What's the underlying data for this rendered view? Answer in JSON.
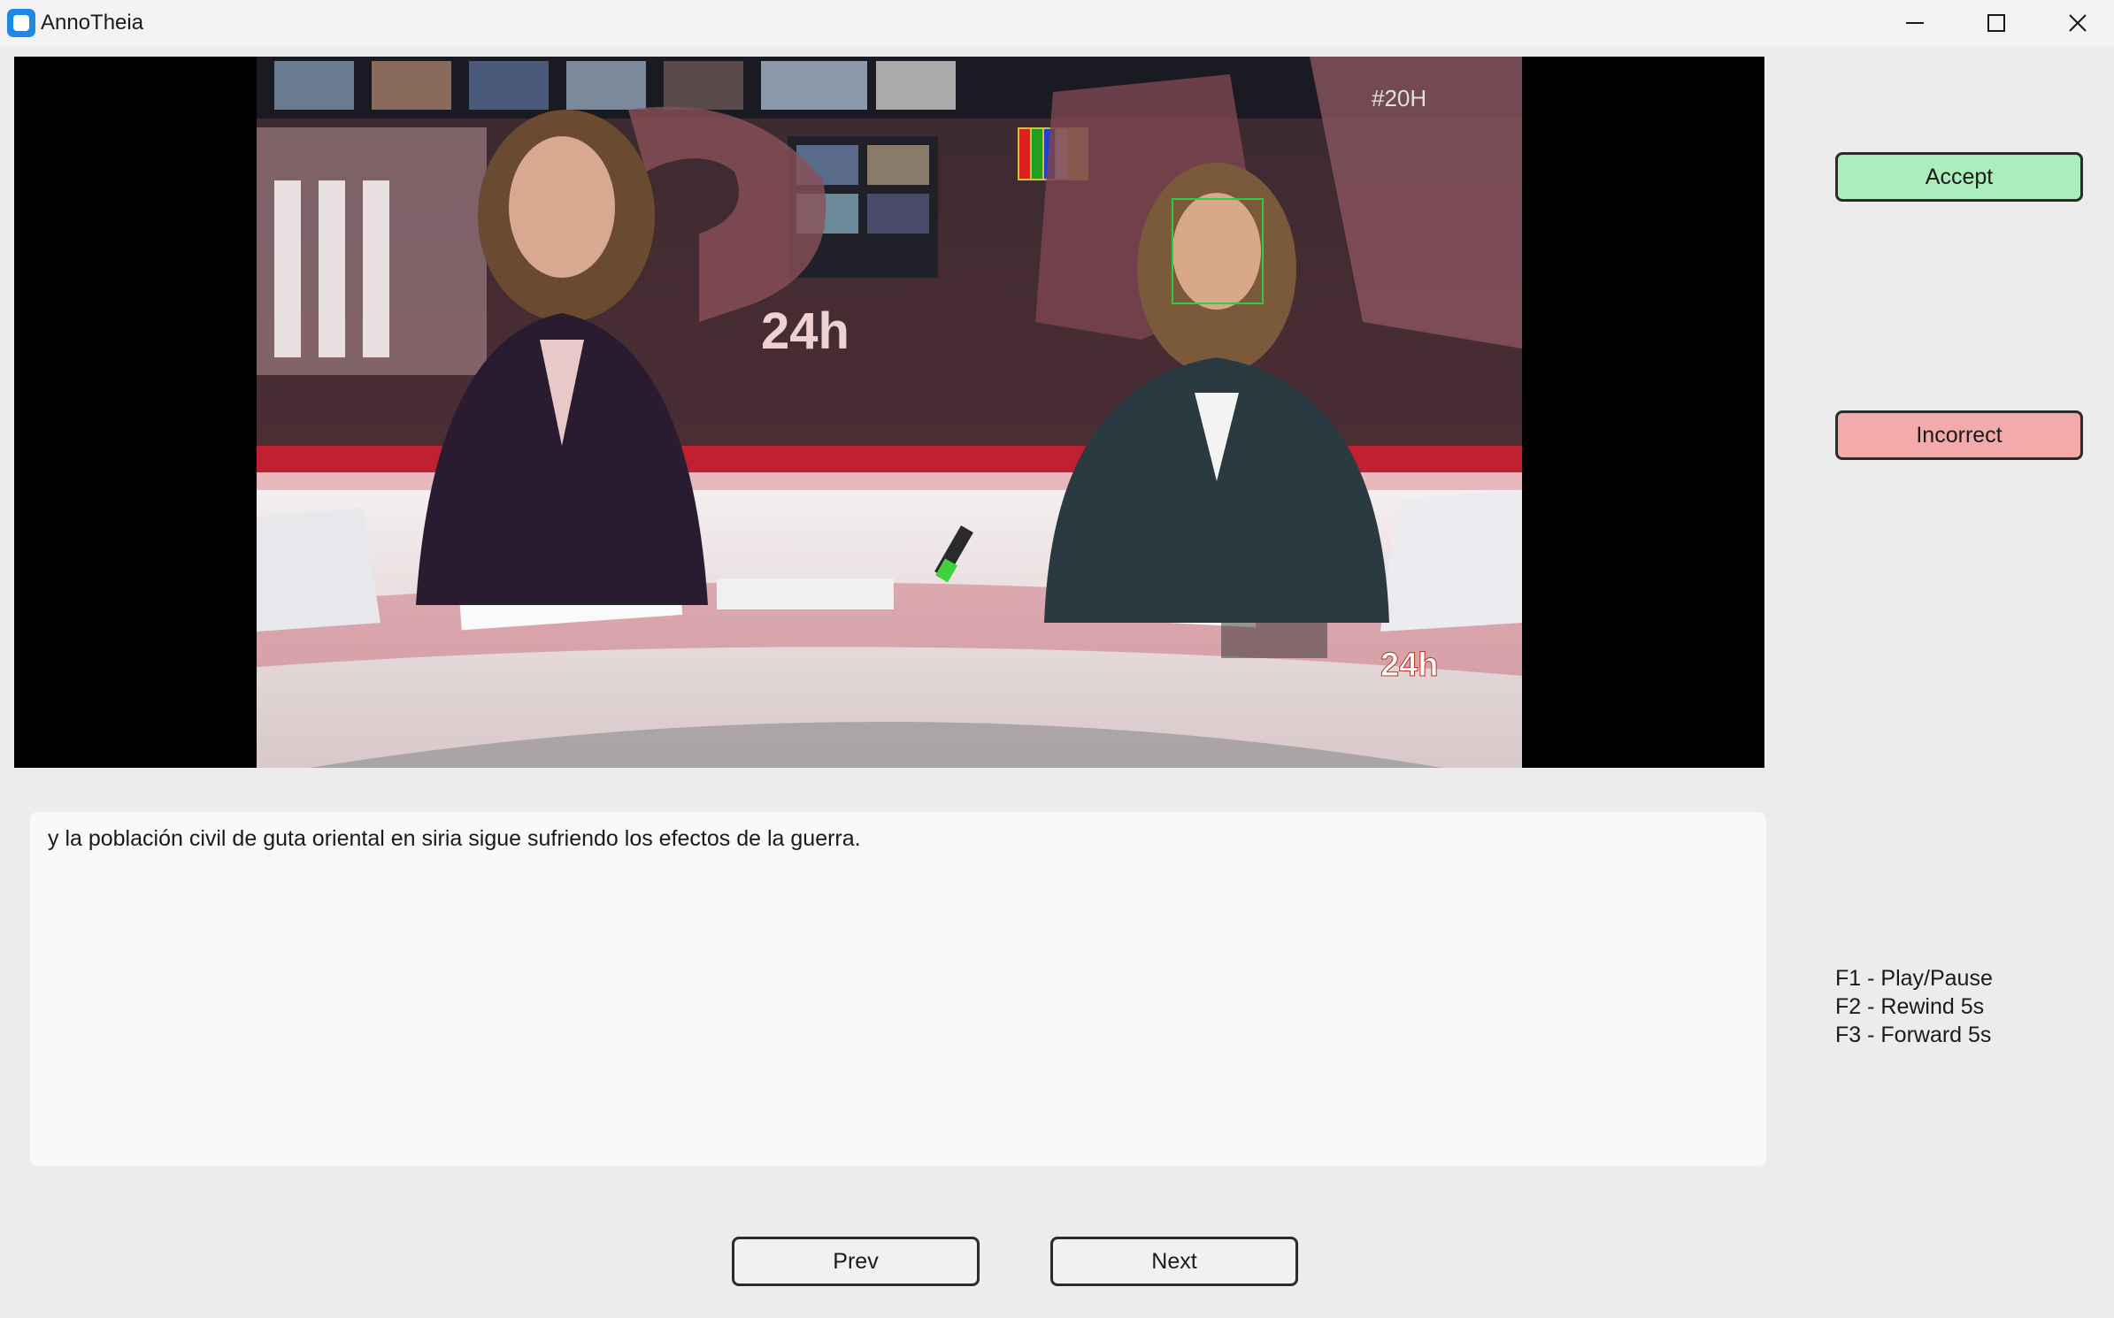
{
  "window": {
    "title": "AnnoTheia",
    "icon": "app-icon"
  },
  "video": {
    "overlay_texts": [
      "#20H",
      "24h",
      "24h"
    ],
    "face_box_color": "#2ecc40"
  },
  "transcript": {
    "text": "y la población civil de guta oriental en siria sigue sufriendo los efectos de la guerra."
  },
  "actions": {
    "accept_label": "Accept",
    "accept_color": "#aaeebb",
    "incorrect_label": "Incorrect",
    "incorrect_color": "#f2aaaa"
  },
  "shortcuts": [
    "F1 - Play/Pause",
    "F2 - Rewind 5s",
    "F3 - Forward 5s"
  ],
  "navigation": {
    "prev_label": "Prev",
    "next_label": "Next"
  }
}
